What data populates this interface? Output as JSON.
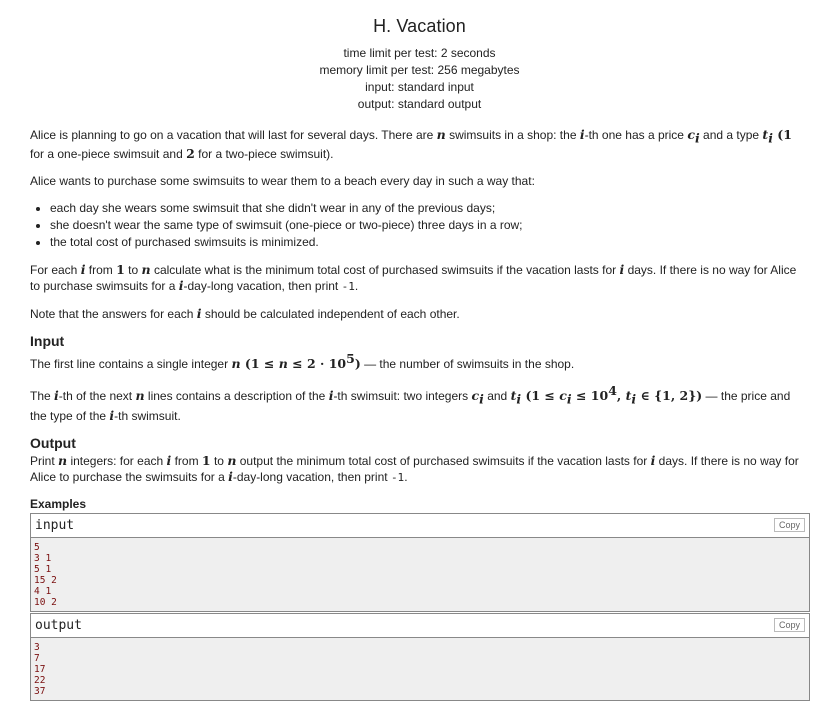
{
  "header": {
    "title": "H. Vacation",
    "time_limit": "time limit per test: 2 seconds",
    "memory_limit": "memory limit per test: 256 megabytes",
    "input": "input: standard input",
    "output": "output: standard output"
  },
  "statement": {
    "p1_a": "Alice is planning to go on a vacation that will last for several days. There are ",
    "p1_n": "n",
    "p1_b": " swimsuits in a shop: the ",
    "p1_i": "i",
    "p1_c": "-th one has a price ",
    "p1_ci": "c",
    "p1_sub_i": "i",
    "p1_d": " and a type ",
    "p1_ti": "t",
    "p1_e": " (",
    "p1_one": "1",
    "p1_f": " for a one-piece swimsuit and ",
    "p1_two": "2",
    "p1_g": " for a two-piece swimsuit).",
    "p2": "Alice wants to purchase some swimsuits to wear them to a beach every day in such a way that:",
    "bullets": [
      "each day she wears some swimsuit that she didn't wear in any of the previous days;",
      "she doesn't wear the same type of swimsuit (one-piece or two-piece) three days in a row;",
      "the total cost of purchased swimsuits is minimized."
    ],
    "p3_a": "For each ",
    "p3_b": " from ",
    "p3_c": " to ",
    "p3_d": " calculate what is the minimum total cost of purchased swimsuits if the vacation lasts for ",
    "p3_e": " days. If there is no way for Alice to purchase swimsuits for a ",
    "p3_f": "-day-long vacation, then print ",
    "minus_one": "-1",
    "p3_g": ".",
    "p4_a": "Note that the answers for each ",
    "p4_b": " should be calculated independent of each other."
  },
  "input_section": {
    "title": "Input",
    "l1_a": "The first line contains a single integer ",
    "l1_math": " (1 ≤ ",
    "l1_math2": " ≤ 2 · 10",
    "l1_exp": "5",
    "l1_close": ")",
    "l1_b": " — the number of swimsuits in the shop.",
    "l2_a": "The ",
    "l2_b": "-th of the next ",
    "l2_c": " lines contains a description of the ",
    "l2_d": "-th swimsuit: two integers ",
    "l2_e": " and ",
    "l2_math_open": " (1 ≤ ",
    "l2_math_le": " ≤ 10",
    "l2_exp": "4",
    "l2_comma": ", ",
    "l2_in": " ∈ {1, 2})",
    "l2_f": " — the price and the type of the ",
    "l2_g": "-th swimsuit."
  },
  "output_section": {
    "title": "Output",
    "l1_a": "Print ",
    "l1_b": " integers: for each ",
    "l1_c": " from ",
    "l1_d": " to ",
    "l1_e": " output the minimum total cost of purchased swimsuits if the vacation lasts for ",
    "l1_f": " days. If there is no way for Alice to purchase the swimsuits for a ",
    "l1_g": "-day-long vacation, then print ",
    "l1_h": "."
  },
  "examples": {
    "title": "Examples",
    "input_label": "input",
    "output_label": "output",
    "copy_label": "Copy",
    "input_lines": [
      "5",
      "3 1",
      "5 1",
      "15 2",
      "4 1",
      "10 2"
    ],
    "output_lines": [
      "3",
      "7",
      "17",
      "22",
      "37"
    ]
  },
  "vars": {
    "n": "n",
    "i": "i",
    "c": "c",
    "t": "t",
    "one": "1"
  }
}
